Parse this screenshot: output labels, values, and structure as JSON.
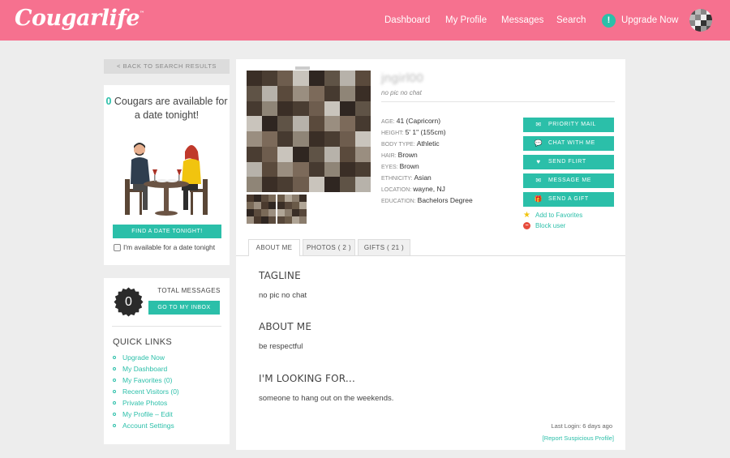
{
  "header": {
    "logo": "Cougarlife",
    "logo_mark": "™",
    "nav": [
      "Dashboard",
      "My Profile",
      "Messages",
      "Search"
    ],
    "upgrade_label": "Upgrade Now",
    "upgrade_icon_text": "!"
  },
  "sidebar": {
    "back_label": "< BACK TO SEARCH RESULTS",
    "date_count": "0",
    "date_text_rest": "Cougars are available for a date tonight!",
    "find_date_label": "FIND A DATE TONIGHT!",
    "available_label": "I'm available for a date tonight",
    "total_messages_count": "0",
    "total_messages_label": "TOTAL MESSAGES",
    "inbox_label": "GO TO MY INBOX",
    "quick_links_title": "QUICK LINKS",
    "quick_links": [
      "Upgrade Now",
      "My Dashboard",
      "My Favorites (0)",
      "Recent Visitors (0)",
      "Private Photos",
      "My Profile – Edit",
      "Account Settings"
    ]
  },
  "profile": {
    "username": "jngirl00",
    "subtitle": "no pic no chat",
    "details": [
      {
        "key": "AGE:",
        "value": "41 (Capricorn)"
      },
      {
        "key": "HEIGHT:",
        "value": "5' 1\" (155cm)"
      },
      {
        "key": "BODY TYPE:",
        "value": "Athletic"
      },
      {
        "key": "HAIR:",
        "value": "Brown"
      },
      {
        "key": "EYES:",
        "value": "Brown"
      },
      {
        "key": "ETHNICITY:",
        "value": "Asian"
      },
      {
        "key": "LOCATION:",
        "value": "wayne, NJ"
      },
      {
        "key": "EDUCATION:",
        "value": "Bachelors Degree"
      }
    ],
    "actions": [
      {
        "label": "PRIORITY MAIL",
        "icon": "priority-mail-icon",
        "glyph": "✉+"
      },
      {
        "label": "CHAT WITH ME",
        "icon": "chat-icon",
        "glyph": "💬"
      },
      {
        "label": "SEND FLIRT",
        "icon": "heart-icon",
        "glyph": "♥"
      },
      {
        "label": "MESSAGE ME",
        "icon": "envelope-icon",
        "glyph": "✉"
      },
      {
        "label": "SEND A GIFT",
        "icon": "gift-icon",
        "glyph": "🎁"
      }
    ],
    "add_favorites": "Add to Favorites",
    "block_user": "Block user",
    "tabs": [
      "ABOUT ME",
      "PHOTOS ( 2 )",
      "GIFTS ( 21 )"
    ],
    "sections": [
      {
        "heading": "TAGLINE",
        "body": "no pic no chat"
      },
      {
        "heading": "ABOUT ME",
        "body": "be respectful"
      },
      {
        "heading": "I'M LOOKING FOR...",
        "body": "someone to hang out on the weekends."
      }
    ],
    "last_login": "Last Login: 6 days ago",
    "report": "[Report Suspicious Profile]"
  },
  "colors": {
    "brand_pink": "#f6718f",
    "teal": "#2bbfa9"
  }
}
